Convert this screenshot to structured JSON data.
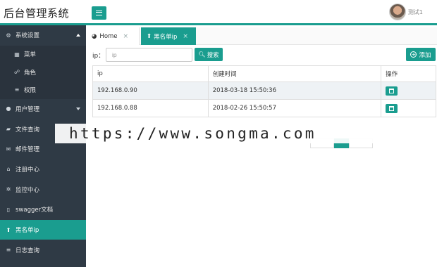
{
  "app": {
    "title": "后台管理系统"
  },
  "header": {
    "user_name": "测试1"
  },
  "sidebar": {
    "items": [
      {
        "label": "系统设置",
        "icon": "gears-icon",
        "expanded": true
      },
      {
        "label": "菜单",
        "icon": "windows-icon",
        "sub": true
      },
      {
        "label": "角色",
        "icon": "users-icon",
        "sub": true
      },
      {
        "label": "权限",
        "icon": "list-icon",
        "sub": true
      },
      {
        "label": "用户管理",
        "icon": "user-icon",
        "expanded": false
      },
      {
        "label": "文件查询",
        "icon": "folder-icon"
      },
      {
        "label": "邮件管理",
        "icon": "envelope-icon"
      },
      {
        "label": "注册中心",
        "icon": "bank-icon"
      },
      {
        "label": "监控中心",
        "icon": "spinner-icon"
      },
      {
        "label": "swagger文档",
        "icon": "file-icon"
      },
      {
        "label": "黑名单ip",
        "icon": "upload-icon",
        "active": true
      },
      {
        "label": "日志查询",
        "icon": "list-icon"
      }
    ]
  },
  "tabs": [
    {
      "label": "Home",
      "icon": "dashboard-icon",
      "active": false
    },
    {
      "label": "黑名单ip",
      "icon": "upload-icon",
      "active": true
    }
  ],
  "search": {
    "label": "ip：",
    "placeholder": "ip",
    "button_label": "搜索"
  },
  "toolbar": {
    "add_label": "添加"
  },
  "table": {
    "columns": [
      "ip",
      "创建时间",
      "操作"
    ],
    "rows": [
      {
        "ip": "192.168.0.90",
        "created": "2018-03-18 15:50:36"
      },
      {
        "ip": "192.168.0.88",
        "created": "2018-02-26 15:50:57"
      }
    ]
  },
  "watermark": {
    "text": "https://www.songma.com"
  },
  "colors": {
    "accent": "#1a9d8f",
    "sidebar": "#2f3a45",
    "sidebar_sub": "#2a333d"
  }
}
